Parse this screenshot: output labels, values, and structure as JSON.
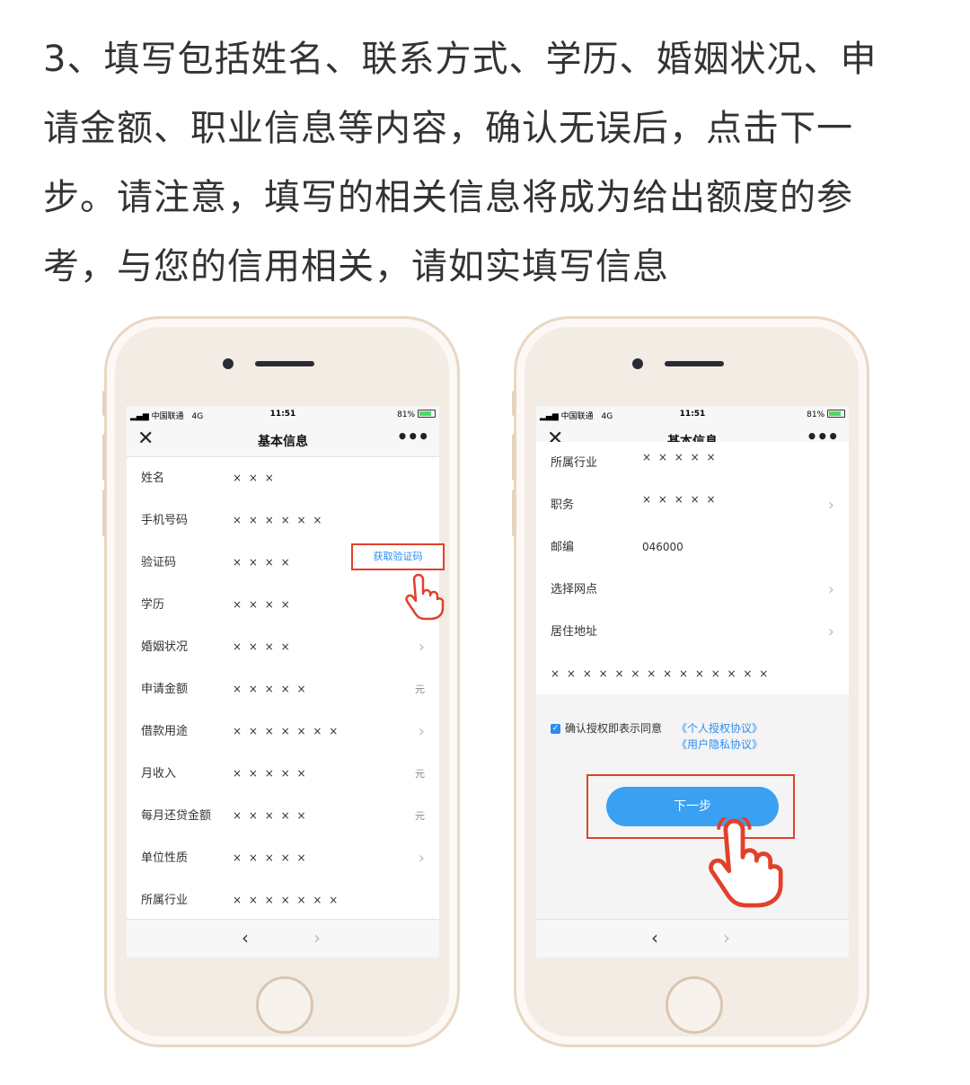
{
  "instruction": {
    "line1": "3、填写包括姓名、联系方式、学历、婚姻状况、申",
    "line2": "请金额、职业信息等内容，确认无误后，点击下一",
    "line3": "步。请注意，填写的相关信息将成为给出额度的参",
    "line4": "考，与您的信用相关，请如实填写信息"
  },
  "status_bar": {
    "carrier": "中国联通",
    "network": "4G",
    "time": "11:51",
    "battery": "81%"
  },
  "nav": {
    "title": "基本信息"
  },
  "left_form": {
    "rows": [
      {
        "label": "姓名",
        "value": "× × ×"
      },
      {
        "label": "手机号码",
        "value": "× × × × × ×"
      },
      {
        "label": "验证码",
        "value": "× × × ×"
      },
      {
        "label": "学历",
        "value": "× × × ×"
      },
      {
        "label": "婚姻状况",
        "value": "× × × ×"
      },
      {
        "label": "申请金额",
        "value": "× × × × ×",
        "suffix": "元"
      },
      {
        "label": "借款用途",
        "value": "× × × × × × ×"
      },
      {
        "label": "月收入",
        "value": "× × × × ×",
        "suffix": "元"
      },
      {
        "label": "每月还贷金额",
        "value": "× × × × ×",
        "suffix": "元"
      },
      {
        "label": "单位性质",
        "value": "× × × × ×"
      },
      {
        "label": "所属行业",
        "value": "× × × × × × ×"
      }
    ],
    "sms_button": "获取验证码"
  },
  "right_form": {
    "rows": [
      {
        "label": "所属行业",
        "value": "× × × × ×"
      },
      {
        "label": "职务",
        "value": "× × × × ×"
      },
      {
        "label": "邮编",
        "value": "046000"
      },
      {
        "label": "选择网点",
        "value": ""
      },
      {
        "label": "居住地址",
        "value": ""
      }
    ],
    "address_value": "× × × × × × × × × × × × × ×",
    "agree_text": "确认授权即表示同意",
    "agreement_link_1": "《个人授权协议》",
    "agreement_link_2": "《用户隐私协议》",
    "next_button": "下一步"
  },
  "icons": [
    "close-icon",
    "more-icon",
    "chevron-right-icon",
    "back-arrow-icon",
    "forward-arrow-icon",
    "checkbox-checked-icon",
    "pointing-hand-icon"
  ],
  "colors": {
    "accent": "#2c8df0",
    "button": "#3aa0f2",
    "highlight": "#e2402a",
    "phone_frame": "#f3ece4"
  }
}
